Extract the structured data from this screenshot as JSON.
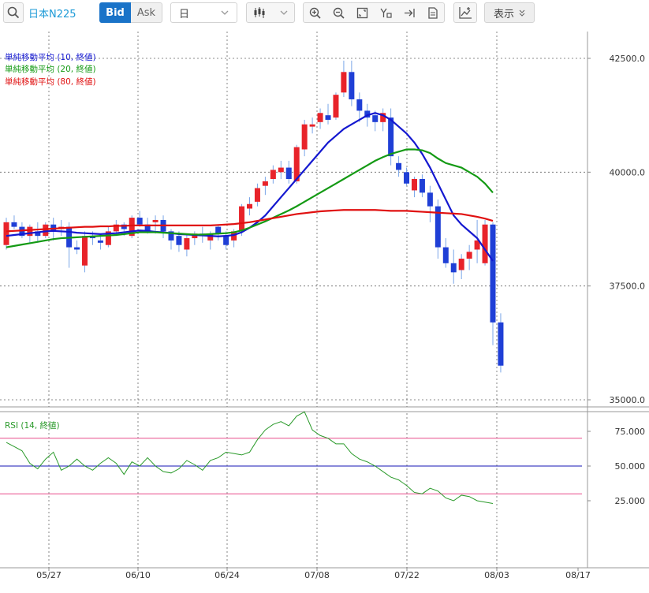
{
  "toolbar": {
    "symbol": "日本N225",
    "bid_label": "Bid",
    "ask_label": "Ask",
    "period_value": "日",
    "display_label": "表示",
    "icons": [
      "search-icon",
      "chevron-down-icon",
      "candlestick-icon",
      "zoom-in-icon",
      "zoom-out-icon",
      "fit-screen-icon",
      "crosshair-icon",
      "jump-to-latest-icon",
      "document-icon",
      "add-indicator-icon",
      "double-chevron-down-icon"
    ]
  },
  "colors": {
    "up": "#e8232a",
    "down": "#1f3fd6",
    "ma10": "#1418d0",
    "ma20": "#149a14",
    "ma80": "#e01010",
    "rsi": "#2a9a2a",
    "rsi_bands": "#e84a8a",
    "rsi_mid": "#1414b4",
    "grid": "#666666"
  },
  "chart_data": [
    {
      "type": "candlestick",
      "title": "日本N225",
      "yticks": [
        "42500.0",
        "40000.0",
        "37500.0",
        "35000.0"
      ],
      "ylim": [
        35000,
        42500
      ],
      "x": [
        "05/16",
        "05/17",
        "05/20",
        "05/21",
        "05/22",
        "05/23",
        "05/24",
        "05/27",
        "05/28",
        "05/29",
        "05/30",
        "05/31",
        "06/03",
        "06/04",
        "06/05",
        "06/06",
        "06/07",
        "06/10",
        "06/11",
        "06/12",
        "06/13",
        "06/14",
        "06/17",
        "06/18",
        "06/19",
        "06/20",
        "06/21",
        "06/24",
        "06/25",
        "06/26",
        "06/27",
        "06/28",
        "07/01",
        "07/02",
        "07/03",
        "07/04",
        "07/05",
        "07/08",
        "07/09",
        "07/10",
        "07/11",
        "07/12",
        "07/15",
        "07/16",
        "07/17",
        "07/18",
        "07/19",
        "07/22",
        "07/23",
        "07/24",
        "07/25",
        "07/26",
        "07/29",
        "07/30",
        "07/31",
        "08/01",
        "08/02"
      ],
      "xticks": [
        "05/27",
        "06/10",
        "06/24",
        "07/08",
        "07/22",
        "08/03",
        "08/17"
      ],
      "ohlc": [
        [
          38400,
          39000,
          38300,
          38900
        ],
        [
          38900,
          39050,
          38750,
          38800
        ],
        [
          38800,
          38900,
          38550,
          38600
        ],
        [
          38600,
          38850,
          38450,
          38800
        ],
        [
          38700,
          38900,
          38450,
          38600
        ],
        [
          38600,
          38900,
          38550,
          38850
        ],
        [
          38850,
          39000,
          38500,
          38700
        ],
        [
          38750,
          38950,
          38600,
          38800
        ],
        [
          38800,
          38900,
          37900,
          38350
        ],
        [
          38350,
          38500,
          38200,
          38300
        ],
        [
          37950,
          38700,
          37800,
          38600
        ],
        [
          38600,
          38700,
          38400,
          38550
        ],
        [
          38500,
          38650,
          38300,
          38450
        ],
        [
          38400,
          38800,
          38350,
          38700
        ],
        [
          38700,
          38950,
          38600,
          38850
        ],
        [
          38850,
          38900,
          38600,
          38750
        ],
        [
          38600,
          39050,
          38550,
          39000
        ],
        [
          39000,
          39150,
          38800,
          38850
        ],
        [
          38850,
          39000,
          38650,
          38700
        ],
        [
          38900,
          39050,
          38650,
          38950
        ],
        [
          38950,
          39050,
          38550,
          38700
        ],
        [
          38700,
          38750,
          38300,
          38500
        ],
        [
          38600,
          38700,
          38250,
          38400
        ],
        [
          38300,
          38650,
          38150,
          38550
        ],
        [
          38550,
          38700,
          38400,
          38650
        ],
        [
          38650,
          38800,
          38450,
          38600
        ],
        [
          38500,
          38700,
          38300,
          38650
        ],
        [
          38800,
          38850,
          38500,
          38650
        ],
        [
          38600,
          38700,
          38300,
          38400
        ],
        [
          38500,
          38750,
          38350,
          38700
        ],
        [
          38700,
          39300,
          38600,
          39250
        ],
        [
          39200,
          39450,
          39050,
          39300
        ],
        [
          39350,
          39750,
          39250,
          39650
        ],
        [
          39700,
          39900,
          39500,
          39800
        ],
        [
          39850,
          40150,
          39750,
          40050
        ],
        [
          40000,
          40250,
          39850,
          40100
        ],
        [
          40100,
          40250,
          39750,
          39850
        ],
        [
          39800,
          40600,
          39750,
          40550
        ],
        [
          40500,
          41150,
          40350,
          41050
        ],
        [
          41000,
          41200,
          40850,
          41050
        ],
        [
          41100,
          41400,
          40950,
          41300
        ],
        [
          41250,
          41500,
          41050,
          41150
        ],
        [
          41200,
          41750,
          41150,
          41700
        ],
        [
          41750,
          42450,
          41650,
          42200
        ],
        [
          42200,
          42450,
          41450,
          41600
        ],
        [
          41600,
          41750,
          41100,
          41350
        ],
        [
          41350,
          41500,
          41000,
          41200
        ],
        [
          41250,
          41350,
          40900,
          41100
        ],
        [
          41100,
          41400,
          40900,
          41300
        ],
        [
          41200,
          41400,
          40150,
          40350
        ],
        [
          40200,
          40350,
          39900,
          40050
        ],
        [
          40000,
          40100,
          39700,
          39750
        ],
        [
          39600,
          39900,
          39450,
          39850
        ],
        [
          39850,
          39950,
          39450,
          39550
        ],
        [
          39550,
          39700,
          38900,
          39250
        ],
        [
          39250,
          39400,
          38100,
          38350
        ],
        [
          38350,
          38550,
          37900,
          38000
        ],
        [
          38000,
          38300,
          37550,
          37800
        ],
        [
          37850,
          38200,
          37650,
          38100
        ],
        [
          38100,
          38400,
          37850,
          38250
        ],
        [
          38300,
          38950,
          38000,
          38500
        ],
        [
          38000,
          38950,
          37950,
          38850
        ],
        [
          38850,
          38900,
          36200,
          36700
        ],
        [
          36700,
          36900,
          35600,
          35750
        ]
      ],
      "series": [
        {
          "name": "単純移動平均 (10, 終値)",
          "color": "#1418d0",
          "values": [
            38600,
            38620,
            38640,
            38660,
            38680,
            38700,
            38710,
            38700,
            38690,
            38670,
            38660,
            38650,
            38640,
            38650,
            38660,
            38680,
            38700,
            38720,
            38710,
            38690,
            38680,
            38660,
            38640,
            38630,
            38620,
            38610,
            38600,
            38590,
            38600,
            38620,
            38680,
            38780,
            38900,
            39050,
            39250,
            39450,
            39650,
            39850,
            40050,
            40250,
            40450,
            40650,
            40800,
            40950,
            41050,
            41150,
            41250,
            41300,
            41250,
            41150,
            41000,
            40850,
            40650,
            40400,
            40100,
            39750,
            39400,
            39050,
            38850,
            38700,
            38550,
            38300,
            38050
          ]
        },
        {
          "name": "単純移動平均 (20, 終値)",
          "color": "#149a14",
          "values": [
            38350,
            38380,
            38410,
            38440,
            38470,
            38500,
            38530,
            38550,
            38560,
            38570,
            38580,
            38590,
            38600,
            38610,
            38620,
            38640,
            38660,
            38680,
            38680,
            38680,
            38670,
            38660,
            38650,
            38640,
            38630,
            38630,
            38640,
            38650,
            38660,
            38680,
            38720,
            38780,
            38850,
            38920,
            39000,
            39080,
            39160,
            39250,
            39350,
            39450,
            39550,
            39650,
            39750,
            39850,
            39950,
            40050,
            40150,
            40250,
            40330,
            40400,
            40450,
            40500,
            40500,
            40480,
            40420,
            40300,
            40200,
            40150,
            40100,
            40000,
            39900,
            39750,
            39550
          ]
        },
        {
          "name": "単純移動平均 (80, 終値)",
          "color": "#e01010",
          "values": [
            38700,
            38710,
            38720,
            38730,
            38740,
            38750,
            38760,
            38770,
            38780,
            38790,
            38800,
            38800,
            38810,
            38810,
            38820,
            38820,
            38830,
            38830,
            38830,
            38830,
            38830,
            38830,
            38830,
            38830,
            38830,
            38830,
            38830,
            38840,
            38850,
            38860,
            38880,
            38900,
            38930,
            38960,
            38990,
            39020,
            39050,
            39080,
            39100,
            39120,
            39140,
            39150,
            39160,
            39170,
            39170,
            39170,
            39170,
            39170,
            39160,
            39150,
            39150,
            39150,
            39140,
            39130,
            39120,
            39110,
            39100,
            39090,
            39080,
            39050,
            39020,
            38980,
            38930
          ]
        }
      ]
    },
    {
      "type": "line",
      "title": "RSI (14, 終値)",
      "yticks": [
        "75.000",
        "50.000",
        "25.000"
      ],
      "ylim": [
        10,
        100
      ],
      "bands": [
        70,
        50,
        30
      ],
      "series": [
        {
          "name": "RSI (14, 終値)",
          "color": "#2a9a2a",
          "values": [
            67,
            64,
            61,
            52,
            48,
            55,
            60,
            47,
            50,
            55,
            50,
            47,
            52,
            56,
            52,
            44,
            53,
            50,
            56,
            50,
            46,
            45,
            48,
            54,
            51,
            47,
            54,
            56,
            60,
            59,
            58,
            60,
            69,
            76,
            80,
            82,
            79,
            86,
            89,
            76,
            72,
            70,
            66,
            66,
            59,
            55,
            53,
            50,
            46,
            42,
            40,
            36,
            31,
            30,
            34,
            32,
            27,
            25,
            29,
            28,
            25,
            24,
            23
          ]
        }
      ]
    }
  ]
}
